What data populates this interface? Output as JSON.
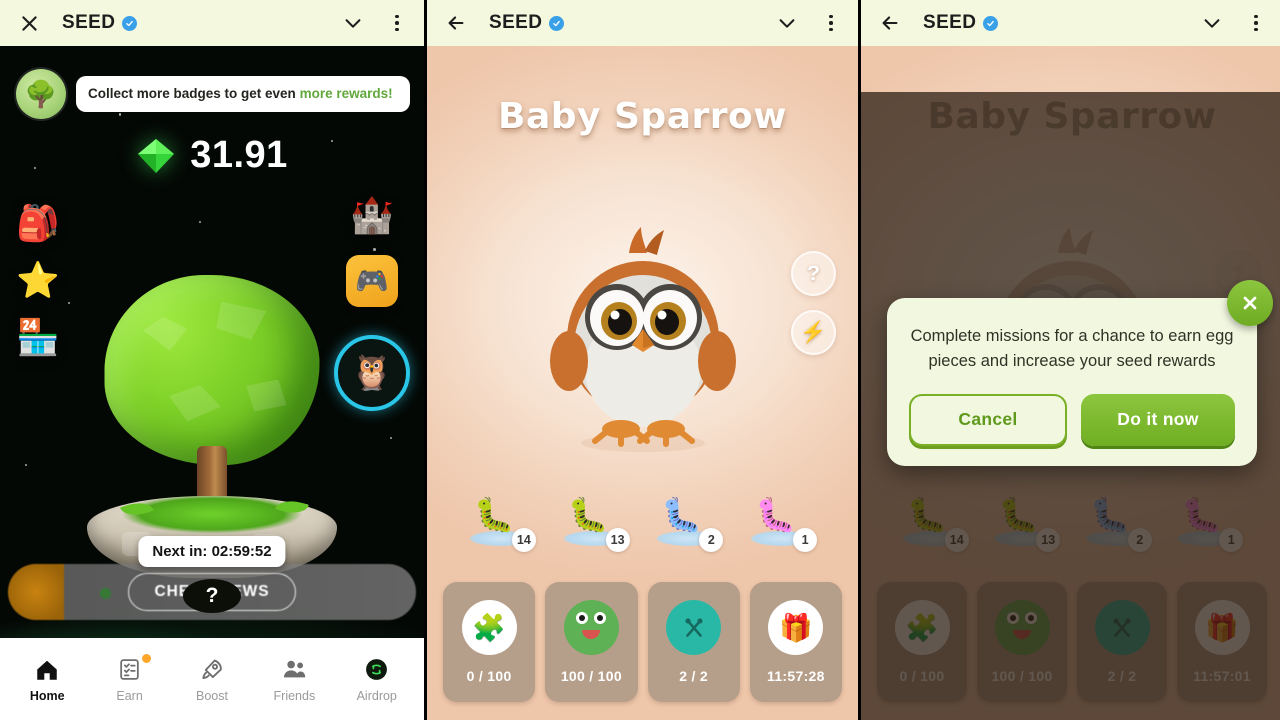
{
  "header": {
    "title": "SEED",
    "verified_icon": "verified-badge-icon",
    "close_icon": "close-icon",
    "back_icon": "back-arrow-icon",
    "collapse_icon": "chevron-down-icon",
    "menu_icon": "more-vertical-icon"
  },
  "home": {
    "banner": {
      "avatar_icon": "tree-avatar-icon",
      "text_plain": "Collect more badges to get even ",
      "text_highlight": "more rewards!"
    },
    "balance": {
      "gem_icon": "green-gem-icon",
      "amount": "31.91"
    },
    "rail_left": [
      {
        "name": "backpack",
        "icon": "🎒"
      },
      {
        "name": "star",
        "icon": "⭐"
      },
      {
        "name": "shop",
        "icon": "🏪"
      }
    ],
    "rail_right": [
      {
        "name": "castle",
        "icon": "🏰"
      },
      {
        "name": "game",
        "icon": "🎮"
      }
    ],
    "pet_avatar_icon": "🦉",
    "next_label": "Next in:",
    "next_time": "02:59:52",
    "question_mark": "?",
    "check_news_label": "CHECK NEWS",
    "nav": [
      {
        "label": "Home",
        "icon": "home-icon",
        "active": true,
        "badge": false
      },
      {
        "label": "Earn",
        "icon": "tasks-icon",
        "active": false,
        "badge": true
      },
      {
        "label": "Boost",
        "icon": "rocket-icon",
        "active": false,
        "badge": false
      },
      {
        "label": "Friends",
        "icon": "people-icon",
        "active": false,
        "badge": false
      },
      {
        "label": "Airdrop",
        "icon": "airdrop-icon",
        "active": false,
        "badge": false
      }
    ]
  },
  "pet": {
    "title": "Baby Sparrow",
    "art_icon": "baby-owl-illustration",
    "side_buttons": [
      {
        "name": "help",
        "glyph": "?"
      },
      {
        "name": "boost",
        "glyph": "⚡"
      }
    ],
    "worms": [
      {
        "name": "worm-tan",
        "emoji": "🐛",
        "count": "14",
        "color": "#c9bf6a"
      },
      {
        "name": "worm-green",
        "emoji": "🐛",
        "count": "13",
        "color": "#7fc24a"
      },
      {
        "name": "worm-blue",
        "emoji": "🐛",
        "count": "2",
        "color": "#3aa8e8"
      },
      {
        "name": "worm-purple",
        "emoji": "🐛",
        "count": "1",
        "color": "#b257c9"
      }
    ],
    "cards": [
      {
        "name": "puzzle",
        "icon": "🧩",
        "label": "0 / 100",
        "kind": "plain"
      },
      {
        "name": "feed",
        "icon": "",
        "label": "100 / 100",
        "kind": "frog"
      },
      {
        "name": "meals",
        "icon": "✕",
        "label": "2 / 2",
        "kind": "teal"
      },
      {
        "name": "gift",
        "icon": "🎁",
        "label": "11:57:28",
        "kind": "plain"
      }
    ]
  },
  "modal_screen": {
    "title": "Baby Sparrow",
    "worms": [
      {
        "count": "14"
      },
      {
        "count": "13"
      },
      {
        "count": "2"
      },
      {
        "count": "1"
      }
    ],
    "cards": [
      {
        "icon": "🧩",
        "label": "0 / 100",
        "kind": "plain"
      },
      {
        "icon": "",
        "label": "100 / 100",
        "kind": "frog"
      },
      {
        "icon": "✕",
        "label": "2 / 2",
        "kind": "teal"
      },
      {
        "icon": "🎁",
        "label": "11:57:01",
        "kind": "plain"
      }
    ],
    "dialog": {
      "message": "Complete missions for a chance to earn egg pieces and increase your seed rewards",
      "cancel_label": "Cancel",
      "confirm_label": "Do it now",
      "close_icon": "close-icon"
    }
  },
  "colors": {
    "header_bg": "#f4f8df",
    "accent_green": "#7ab026",
    "confirm_green": "#6fae22",
    "verified_blue": "#3aa0e8",
    "pet_ring_cyan": "#29c6e8",
    "card_bg": "#b69f8a"
  }
}
